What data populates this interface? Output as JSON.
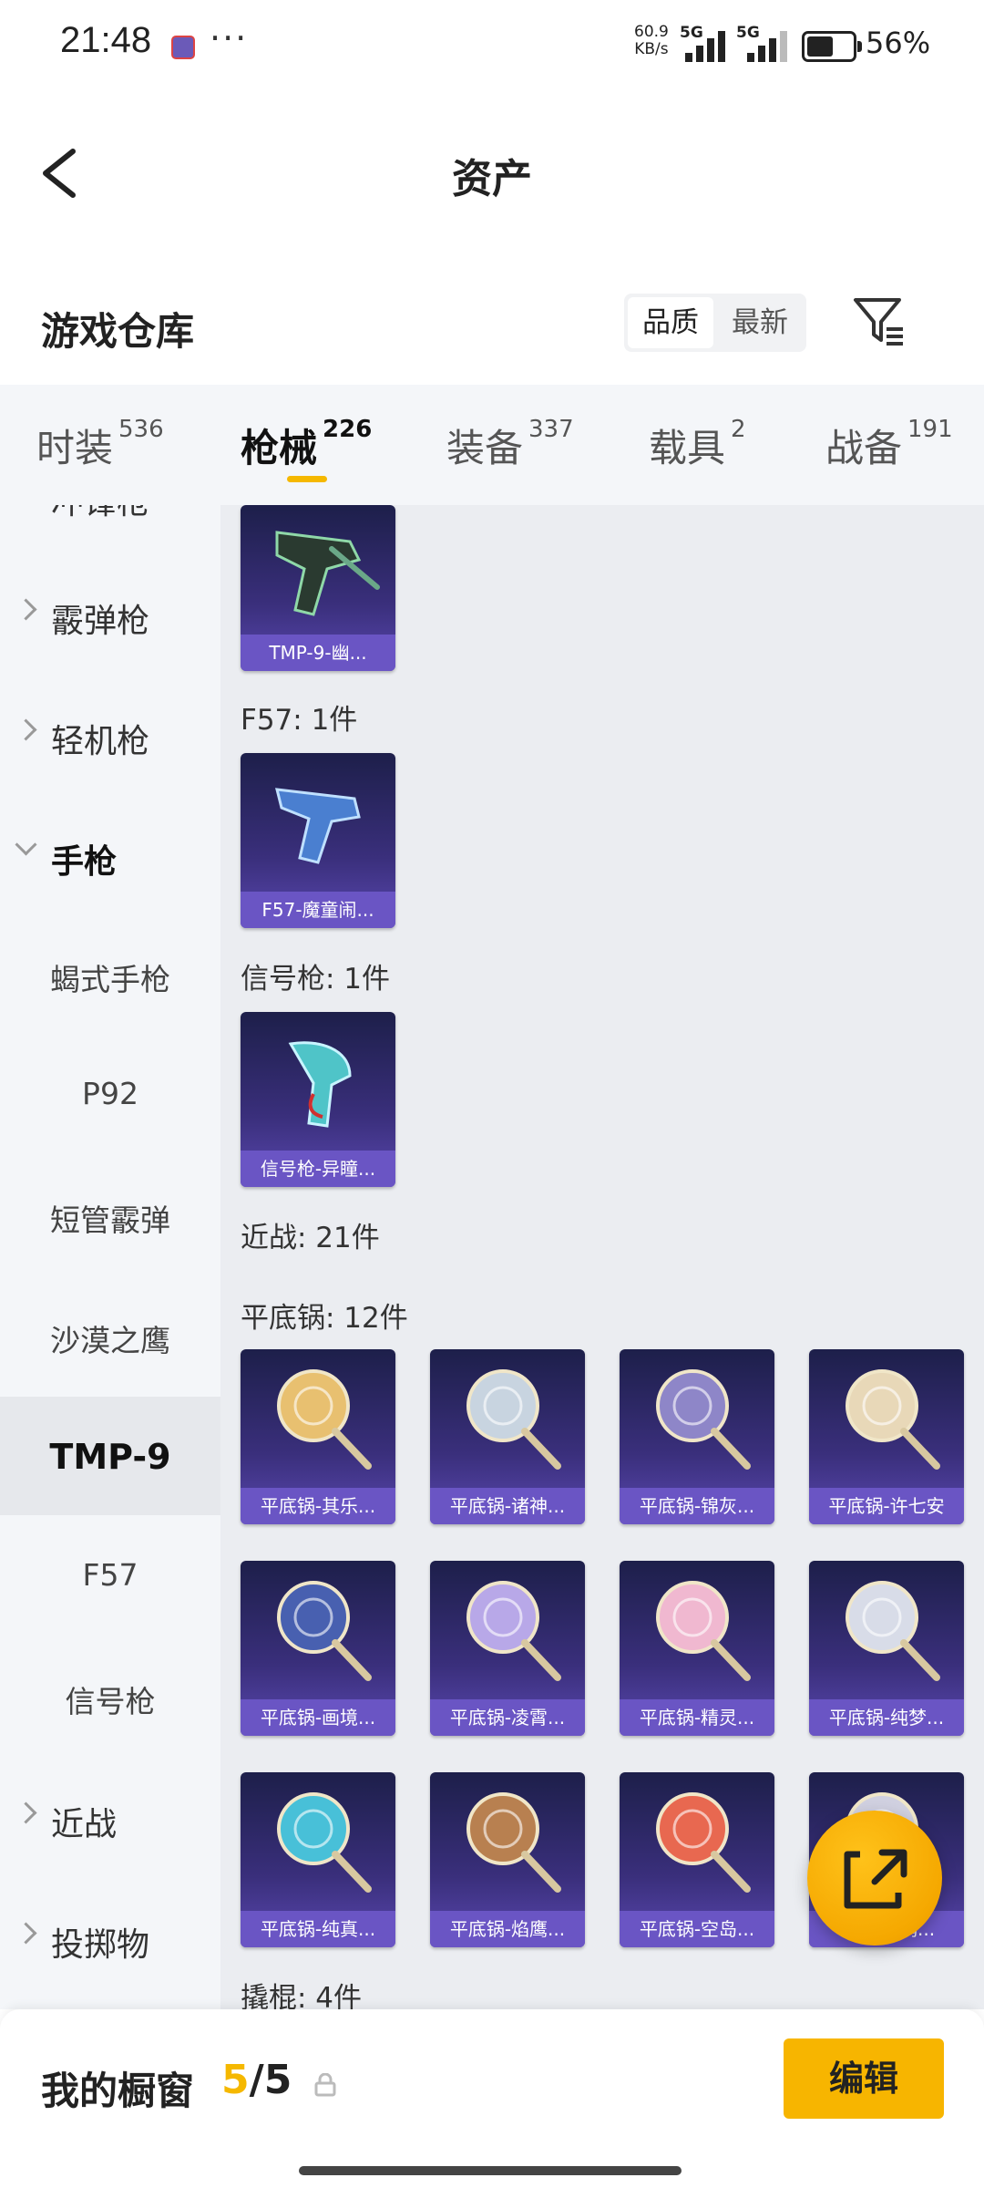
{
  "status_bar": {
    "time": "21:48",
    "net_speed_value": "60.9",
    "net_speed_unit": "KB/s",
    "signal1": "5G",
    "signal2": "5G",
    "battery": "56%",
    "more": "···"
  },
  "header": {
    "title": "资产"
  },
  "section": {
    "title": "游戏仓库",
    "sort_options": [
      "品质",
      "最新"
    ],
    "sort_selected": "品质"
  },
  "tabs": [
    {
      "label": "时装",
      "count": "536"
    },
    {
      "label": "枪械",
      "count": "226"
    },
    {
      "label": "装备",
      "count": "337"
    },
    {
      "label": "载具",
      "count": "2"
    },
    {
      "label": "战备",
      "count": "191"
    }
  ],
  "active_tab": "枪械",
  "sidebar": {
    "cut_top": "冲锋枪",
    "items": [
      {
        "label": "霰弹枪"
      },
      {
        "label": "轻机枪"
      },
      {
        "label": "手枪"
      },
      {
        "label": "蝎式手枪"
      },
      {
        "label": "P92"
      },
      {
        "label": "短管霰弹"
      },
      {
        "label": "沙漠之鹰"
      },
      {
        "label": "TMP-9"
      },
      {
        "label": "F57"
      },
      {
        "label": "信号枪"
      },
      {
        "label": "近战"
      },
      {
        "label": "投掷物"
      }
    ]
  },
  "content": {
    "top_card": "TMP-9-幽...",
    "groups": [
      {
        "heading": "F57: 1件",
        "cards": [
          "F57-魔童闹..."
        ]
      },
      {
        "heading": "信号枪: 1件",
        "cards": [
          "信号枪-异瞳..."
        ]
      },
      {
        "heading": "近战: 21件",
        "cards": []
      },
      {
        "heading": "平底锅: 12件",
        "cards": [
          "平底锅-其乐...",
          "平底锅-诸神...",
          "平底锅-锦灰...",
          "平底锅-许七安",
          "平底锅-画境...",
          "平底锅-凌霄...",
          "平底锅-精灵...",
          "平底锅-纯梦...",
          "平底锅-纯真...",
          "平底锅-焰鹰...",
          "平底锅-空岛...",
          "平底锅-鸿..."
        ]
      },
      {
        "heading": "撬棍: 4件",
        "cards": []
      }
    ]
  },
  "bottom_bar": {
    "label": "我的橱窗",
    "current": "5",
    "total": "/5",
    "edit_label": "编辑"
  },
  "colors": {
    "accent": "#f5b800",
    "card_bg": "#3a2f7c",
    "card_caption": "#6a55c4",
    "sidebar_bg": "#f4f6f9",
    "content_bg": "#ebedf1"
  }
}
